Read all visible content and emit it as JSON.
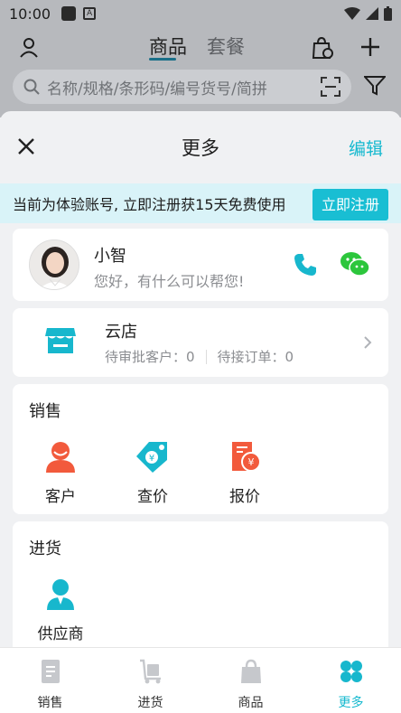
{
  "status_bar": {
    "time": "10:00"
  },
  "background_app": {
    "tabs": [
      "商品",
      "套餐"
    ],
    "search_placeholder": "名称/规格/条形码/编号货号/简拼"
  },
  "sheet": {
    "title": "更多",
    "edit_label": "编辑",
    "trial_banner": {
      "text": "当前为体验账号, 立即注册获15天免费使用",
      "button_label": "立即注册"
    },
    "assistant": {
      "name": "小智",
      "greeting": "您好，有什么可以帮您!"
    },
    "store": {
      "name": "云店",
      "pending_customers": "待审批客户：0",
      "pending_orders": "待接订单：0"
    },
    "sales": {
      "title": "销售",
      "items": [
        {
          "label": "客户",
          "icon": "customer-icon"
        },
        {
          "label": "查价",
          "icon": "price-tag-icon"
        },
        {
          "label": "报价",
          "icon": "quote-icon"
        }
      ]
    },
    "purchase": {
      "title": "进货",
      "items": [
        {
          "label": "供应商",
          "icon": "supplier-icon"
        }
      ]
    }
  },
  "bottom_nav": {
    "items": [
      {
        "label": "销售",
        "icon": "document-icon",
        "active": false
      },
      {
        "label": "进货",
        "icon": "cart-icon",
        "active": false
      },
      {
        "label": "商品",
        "icon": "bag-icon",
        "active": false
      },
      {
        "label": "更多",
        "icon": "clover-icon",
        "active": true
      }
    ]
  },
  "colors": {
    "accent": "#15b9cf",
    "sales_icon": "#f25a3c",
    "purchase_icon": "#17b7cd"
  }
}
